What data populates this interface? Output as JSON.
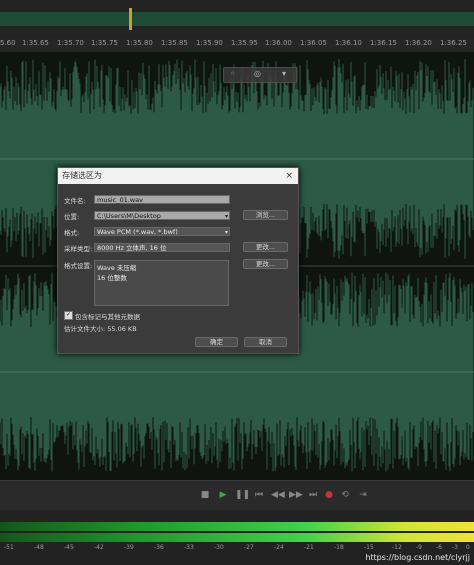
{
  "ruler": {
    "ticks": [
      "5.60",
      "1:35.65",
      "1:35.70",
      "1:35.75",
      "1:35.80",
      "1:35.85",
      "1:35.90",
      "1:35.95",
      "1:36.00",
      "1:36.05",
      "1:36.10",
      "1:36.15",
      "1:36.20",
      "1:36.25"
    ]
  },
  "dialog": {
    "title": "存储选区为",
    "close_icon": "×",
    "filename_label": "文件名:",
    "filename_value": "music_01.wav",
    "location_label": "位置:",
    "location_value": "C:\\Users\\M\\Desktop",
    "browse_button": "浏览...",
    "format_label": "格式:",
    "format_value": "Wave PCM (*.wav, *.bwf)",
    "sample_type_label": "采样类型:",
    "sample_type_value": "8000 Hz 立体声, 16 位",
    "change_button_1": "更改...",
    "format_settings_label": "格式设置:",
    "format_settings_line1": "Wave 未压缩",
    "format_settings_line2": "16 位整数",
    "change_button_2": "更改...",
    "include_markers_label": "包含标记与其他元数据",
    "estimated_size": "估计文件大小: 55.06 KB",
    "ok_button": "确定",
    "cancel_button": "取消"
  },
  "meter": {
    "labels": [
      "-51",
      "-48",
      "-45",
      "-42",
      "-39",
      "-36",
      "-33",
      "-30",
      "-27",
      "-24",
      "-21",
      "-18",
      "-15",
      "-12",
      "-9",
      "-6",
      "-3",
      "0"
    ]
  },
  "watermark": "https://blog.csdn.net/clyrjj",
  "colors": {
    "waveform": "#2d5a48",
    "accent_green": "#43d34a"
  }
}
